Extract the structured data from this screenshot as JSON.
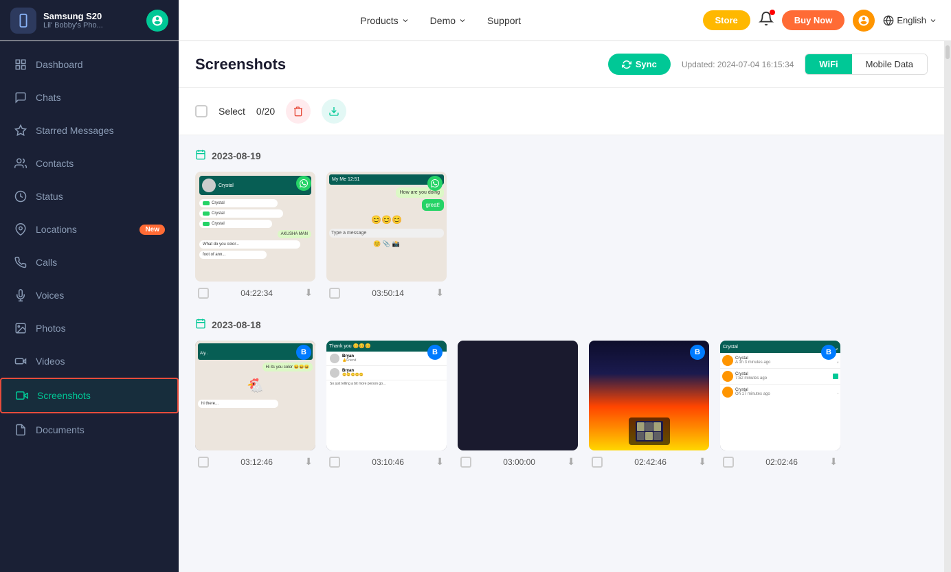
{
  "nav": {
    "device_name": "Samsung S20",
    "device_sub": "Lil' Bobby's Pho...",
    "menu_items": [
      {
        "label": "Products",
        "has_arrow": true
      },
      {
        "label": "Demo",
        "has_arrow": true
      },
      {
        "label": "Support",
        "has_arrow": false
      }
    ],
    "btn_store": "Store",
    "btn_buynow": "Buy Now",
    "lang": "English"
  },
  "sidebar": {
    "items": [
      {
        "id": "dashboard",
        "label": "Dashboard",
        "icon": "dashboard"
      },
      {
        "id": "chats",
        "label": "Chats",
        "icon": "chat"
      },
      {
        "id": "starred",
        "label": "Starred Messages",
        "icon": "star"
      },
      {
        "id": "contacts",
        "label": "Contacts",
        "icon": "contacts"
      },
      {
        "id": "status",
        "label": "Status",
        "icon": "status"
      },
      {
        "id": "locations",
        "label": "Locations",
        "icon": "location",
        "badge": "New"
      },
      {
        "id": "calls",
        "label": "Calls",
        "icon": "calls"
      },
      {
        "id": "voices",
        "label": "Voices",
        "icon": "voices"
      },
      {
        "id": "photos",
        "label": "Photos",
        "icon": "photos"
      },
      {
        "id": "videos",
        "label": "Videos",
        "icon": "videos"
      },
      {
        "id": "screenshots",
        "label": "Screenshots",
        "icon": "screenshots",
        "active": true
      },
      {
        "id": "documents",
        "label": "Documents",
        "icon": "documents"
      }
    ]
  },
  "content": {
    "title": "Screenshots",
    "sync_label": "Sync",
    "updated_text": "Updated: 2024-07-04 16:15:34",
    "wifi_label": "WiFi",
    "mobile_data_label": "Mobile Data",
    "select_label": "Select",
    "select_count": "0/20",
    "sections": [
      {
        "date": "2023-08-19",
        "items": [
          {
            "time": "04:22:34",
            "type": "whatsapp_chat",
            "badge": "wa"
          },
          {
            "time": "03:50:14",
            "type": "whatsapp_chat2",
            "badge": "wa"
          }
        ]
      },
      {
        "date": "2023-08-18",
        "items": [
          {
            "time": "03:12:46",
            "type": "chat_emoji",
            "badge": "b"
          },
          {
            "time": "03:10:46",
            "type": "chat_list",
            "badge": "b"
          },
          {
            "time": "03:00:00",
            "type": "dark_screen",
            "badge": "b"
          },
          {
            "time": "02:42:46",
            "type": "city_night",
            "badge": "b"
          },
          {
            "time": "02:02:46",
            "type": "contacts_list",
            "badge": "b"
          }
        ]
      }
    ]
  }
}
